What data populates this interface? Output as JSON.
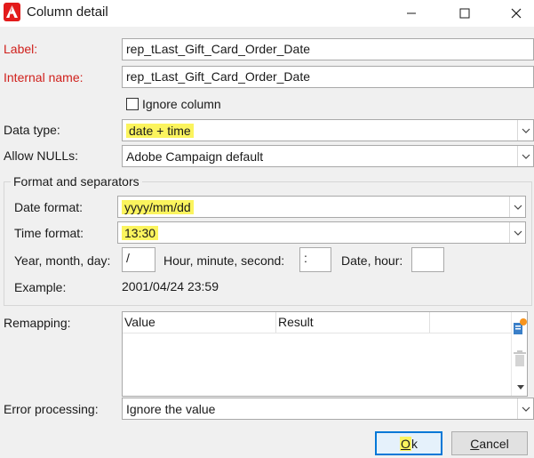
{
  "window": {
    "title": "Column detail",
    "minimize_glyph": "—",
    "maximize_glyph": "☐",
    "close_glyph": "✕"
  },
  "form": {
    "label_label": "Label:",
    "label_value": "rep_tLast_Gift_Card_Order_Date",
    "internal_name_label": "Internal name:",
    "internal_name_value": "rep_tLast_Gift_Card_Order_Date",
    "ignore_column_label": "Ignore column",
    "ignore_column_checked": false,
    "data_type_label": "Data type:",
    "data_type_value": "date + time",
    "allow_nulls_label": "Allow NULLs:",
    "allow_nulls_value": "Adobe Campaign default"
  },
  "format_group": {
    "title": "Format and separators",
    "date_format_label": "Date format:",
    "date_format_value": "yyyy/mm/dd",
    "time_format_label": "Time format:",
    "time_format_value": "13:30",
    "ymd_label": "Year, month, day:",
    "ymd_value": "/",
    "hms_label": "Hour, minute, second:",
    "hms_value": ":",
    "date_hour_label": "Date, hour:",
    "date_hour_value": "",
    "example_label": "Example:",
    "example_value": "2001/04/24 23:59"
  },
  "remapping": {
    "label": "Remapping:",
    "columns": [
      "Value",
      "Result"
    ]
  },
  "error_processing": {
    "label": "Error processing:",
    "value": "Ignore the value"
  },
  "buttons": {
    "ok_mnemonic": "O",
    "ok_rest": "k",
    "cancel_mnemonic": "C",
    "cancel_rest": "ancel"
  },
  "colors": {
    "highlight": "#fbf45e",
    "required_label": "#d0201c",
    "app_icon": "#e31b1b",
    "default_button_border": "#0078d7"
  },
  "icons": {
    "app": "adobe-campaign-icon",
    "dropdown": "chevron-down-icon",
    "detail": "detail-icon",
    "delete": "trash-icon"
  }
}
